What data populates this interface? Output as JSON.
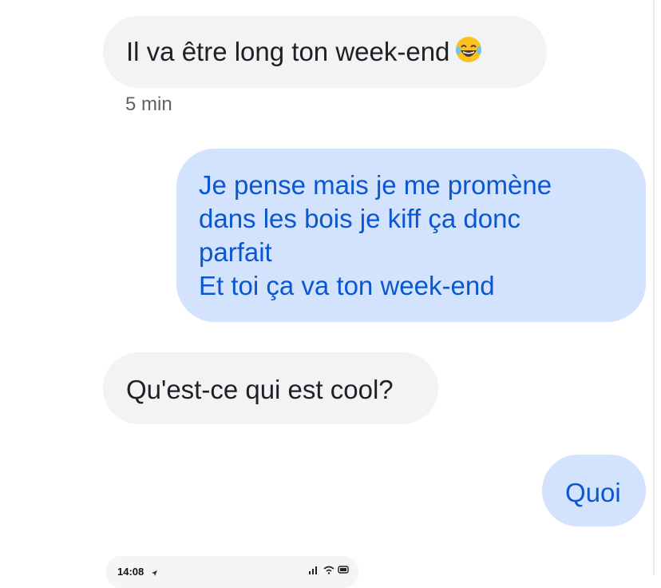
{
  "messages": [
    {
      "direction": "incoming",
      "text": "Il va être long ton week-end",
      "emoji": "face-with-tears-of-joy"
    },
    {
      "direction": "outgoing",
      "text": "Je pense mais je me promène\ndans les bois je kiff ça donc\nparfait\nEt toi ça va ton week-end"
    },
    {
      "direction": "incoming",
      "text": "Qu'est-ce qui est cool?"
    },
    {
      "direction": "outgoing",
      "text": "Quoi"
    }
  ],
  "timestamp": "5 min",
  "attachment": {
    "status_time": "14:08",
    "icons": [
      "location-arrow-icon",
      "signal-icon",
      "wifi-icon",
      "battery-icon"
    ]
  },
  "colors": {
    "incoming_bg": "#f1f3f4",
    "incoming_text": "#202124",
    "outgoing_bg": "#d3e3fd",
    "outgoing_text": "#0b57d0",
    "timestamp_text": "#5f6368"
  }
}
